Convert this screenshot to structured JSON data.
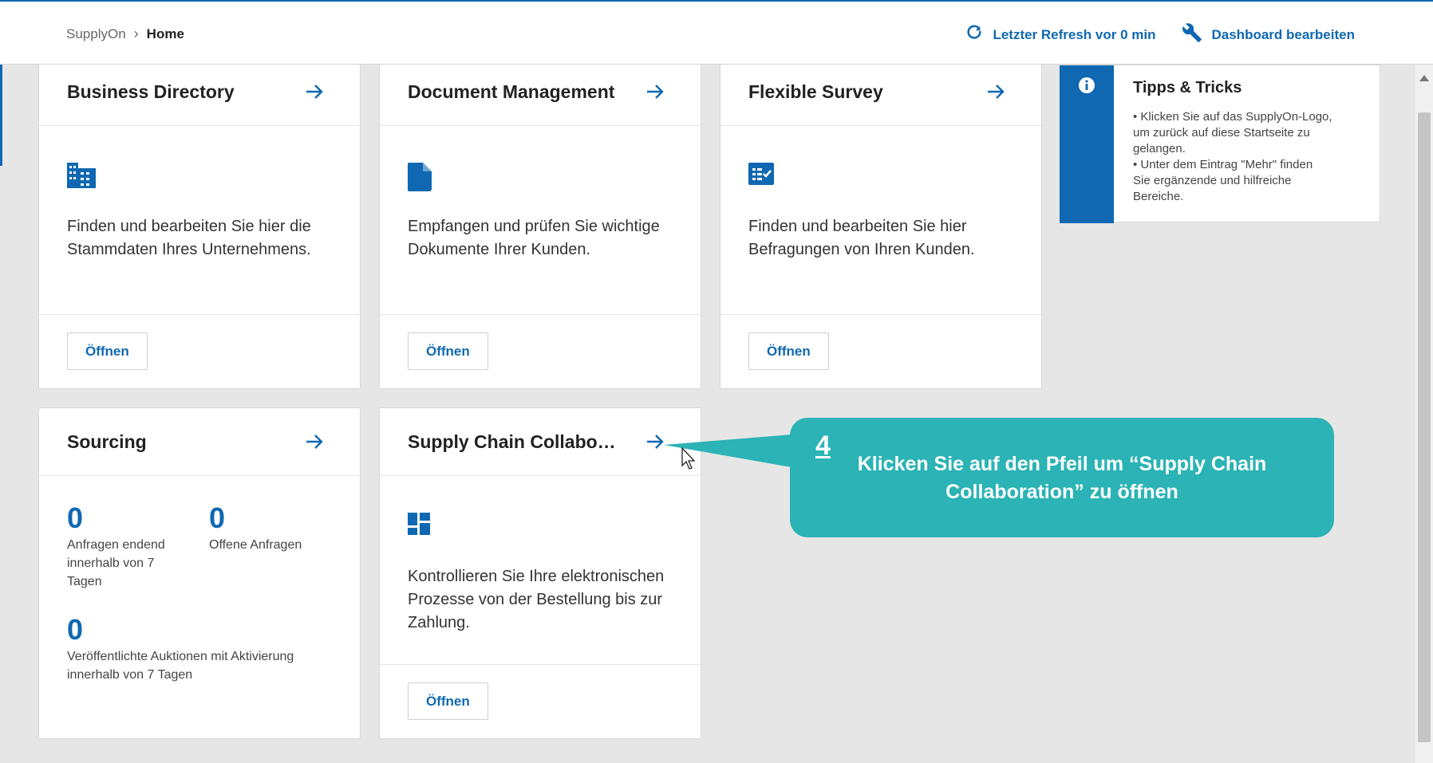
{
  "header": {
    "breadcrumb_root": "SupplyOn",
    "breadcrumb_current": "Home",
    "refresh_label": "Letzter Refresh vor 0 min",
    "edit_label": "Dashboard bearbeiten"
  },
  "cards": {
    "business": {
      "title": "Business Directory",
      "desc": "Finden und bearbeiten Sie hier die Stammdaten Ihres Unternehmens.",
      "button": "Öffnen"
    },
    "document": {
      "title": "Document Management",
      "desc": "Empfangen und prüfen Sie wichtige Dokumente Ihrer Kunden.",
      "button": "Öffnen"
    },
    "survey": {
      "title": "Flexible Survey",
      "desc": "Finden und bearbeiten Sie hier Befragungen von Ihren Kunden.",
      "button": "Öffnen"
    },
    "sourcing": {
      "title": "Sourcing",
      "stat1_value": "0",
      "stat1_label": "Anfragen endend innerhalb von 7 Tagen",
      "stat2_value": "0",
      "stat2_label": "Offene Anfragen",
      "stat3_value": "0",
      "stat3_label": "Veröffentlichte Auktionen mit Aktivierung innerhalb von 7 Tagen"
    },
    "scc": {
      "title": "Supply Chain Collabo…",
      "desc": "Kontrollieren Sie Ihre elektronischen Prozesse von der Bestellung bis zur Zahlung.",
      "button": "Öffnen"
    }
  },
  "tips": {
    "title": "Tipps & Tricks",
    "line1": "• Klicken Sie auf das SupplyOn-Logo, um zurück auf diese Startseite zu gelangen.",
    "line2": "• Unter dem Eintrag \"Mehr\" finden Sie ergänzende und hilfreiche Bereiche."
  },
  "callout": {
    "step": "4",
    "text": "Klicken Sie auf den Pfeil um “Supply Chain Collaboration” zu öffnen"
  },
  "colors": {
    "accent": "#0f68b1",
    "callout": "#2bb3b5",
    "background": "#e6e6e6"
  }
}
